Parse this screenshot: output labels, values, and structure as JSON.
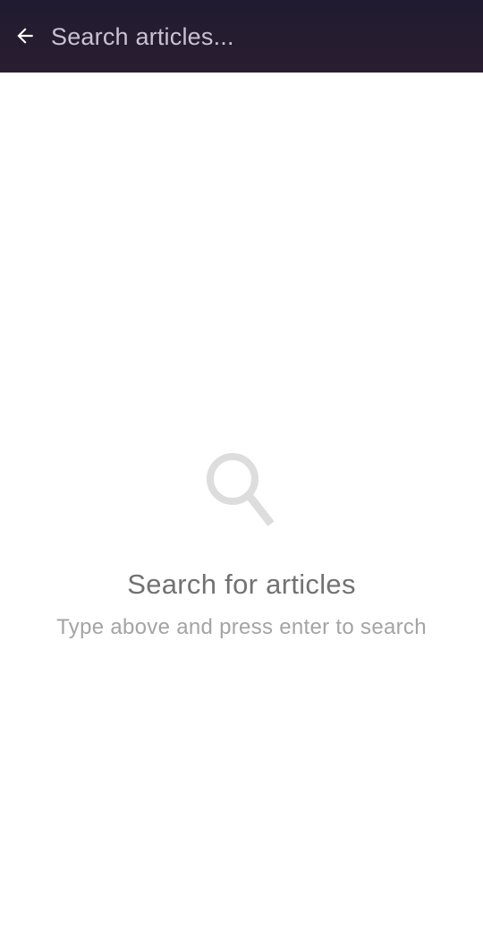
{
  "header": {
    "back_icon": "arrow-left-icon",
    "search_placeholder": "Search articles...",
    "search_value": ""
  },
  "empty_state": {
    "icon": "search-icon",
    "title": "Search for articles",
    "subtitle": "Type above and press enter to search"
  },
  "colors": {
    "header_background": "#231c30",
    "placeholder": "#c8c2d2",
    "title_text": "#727272",
    "subtitle_text": "#a4a4a4",
    "empty_icon": "#dddddd"
  }
}
